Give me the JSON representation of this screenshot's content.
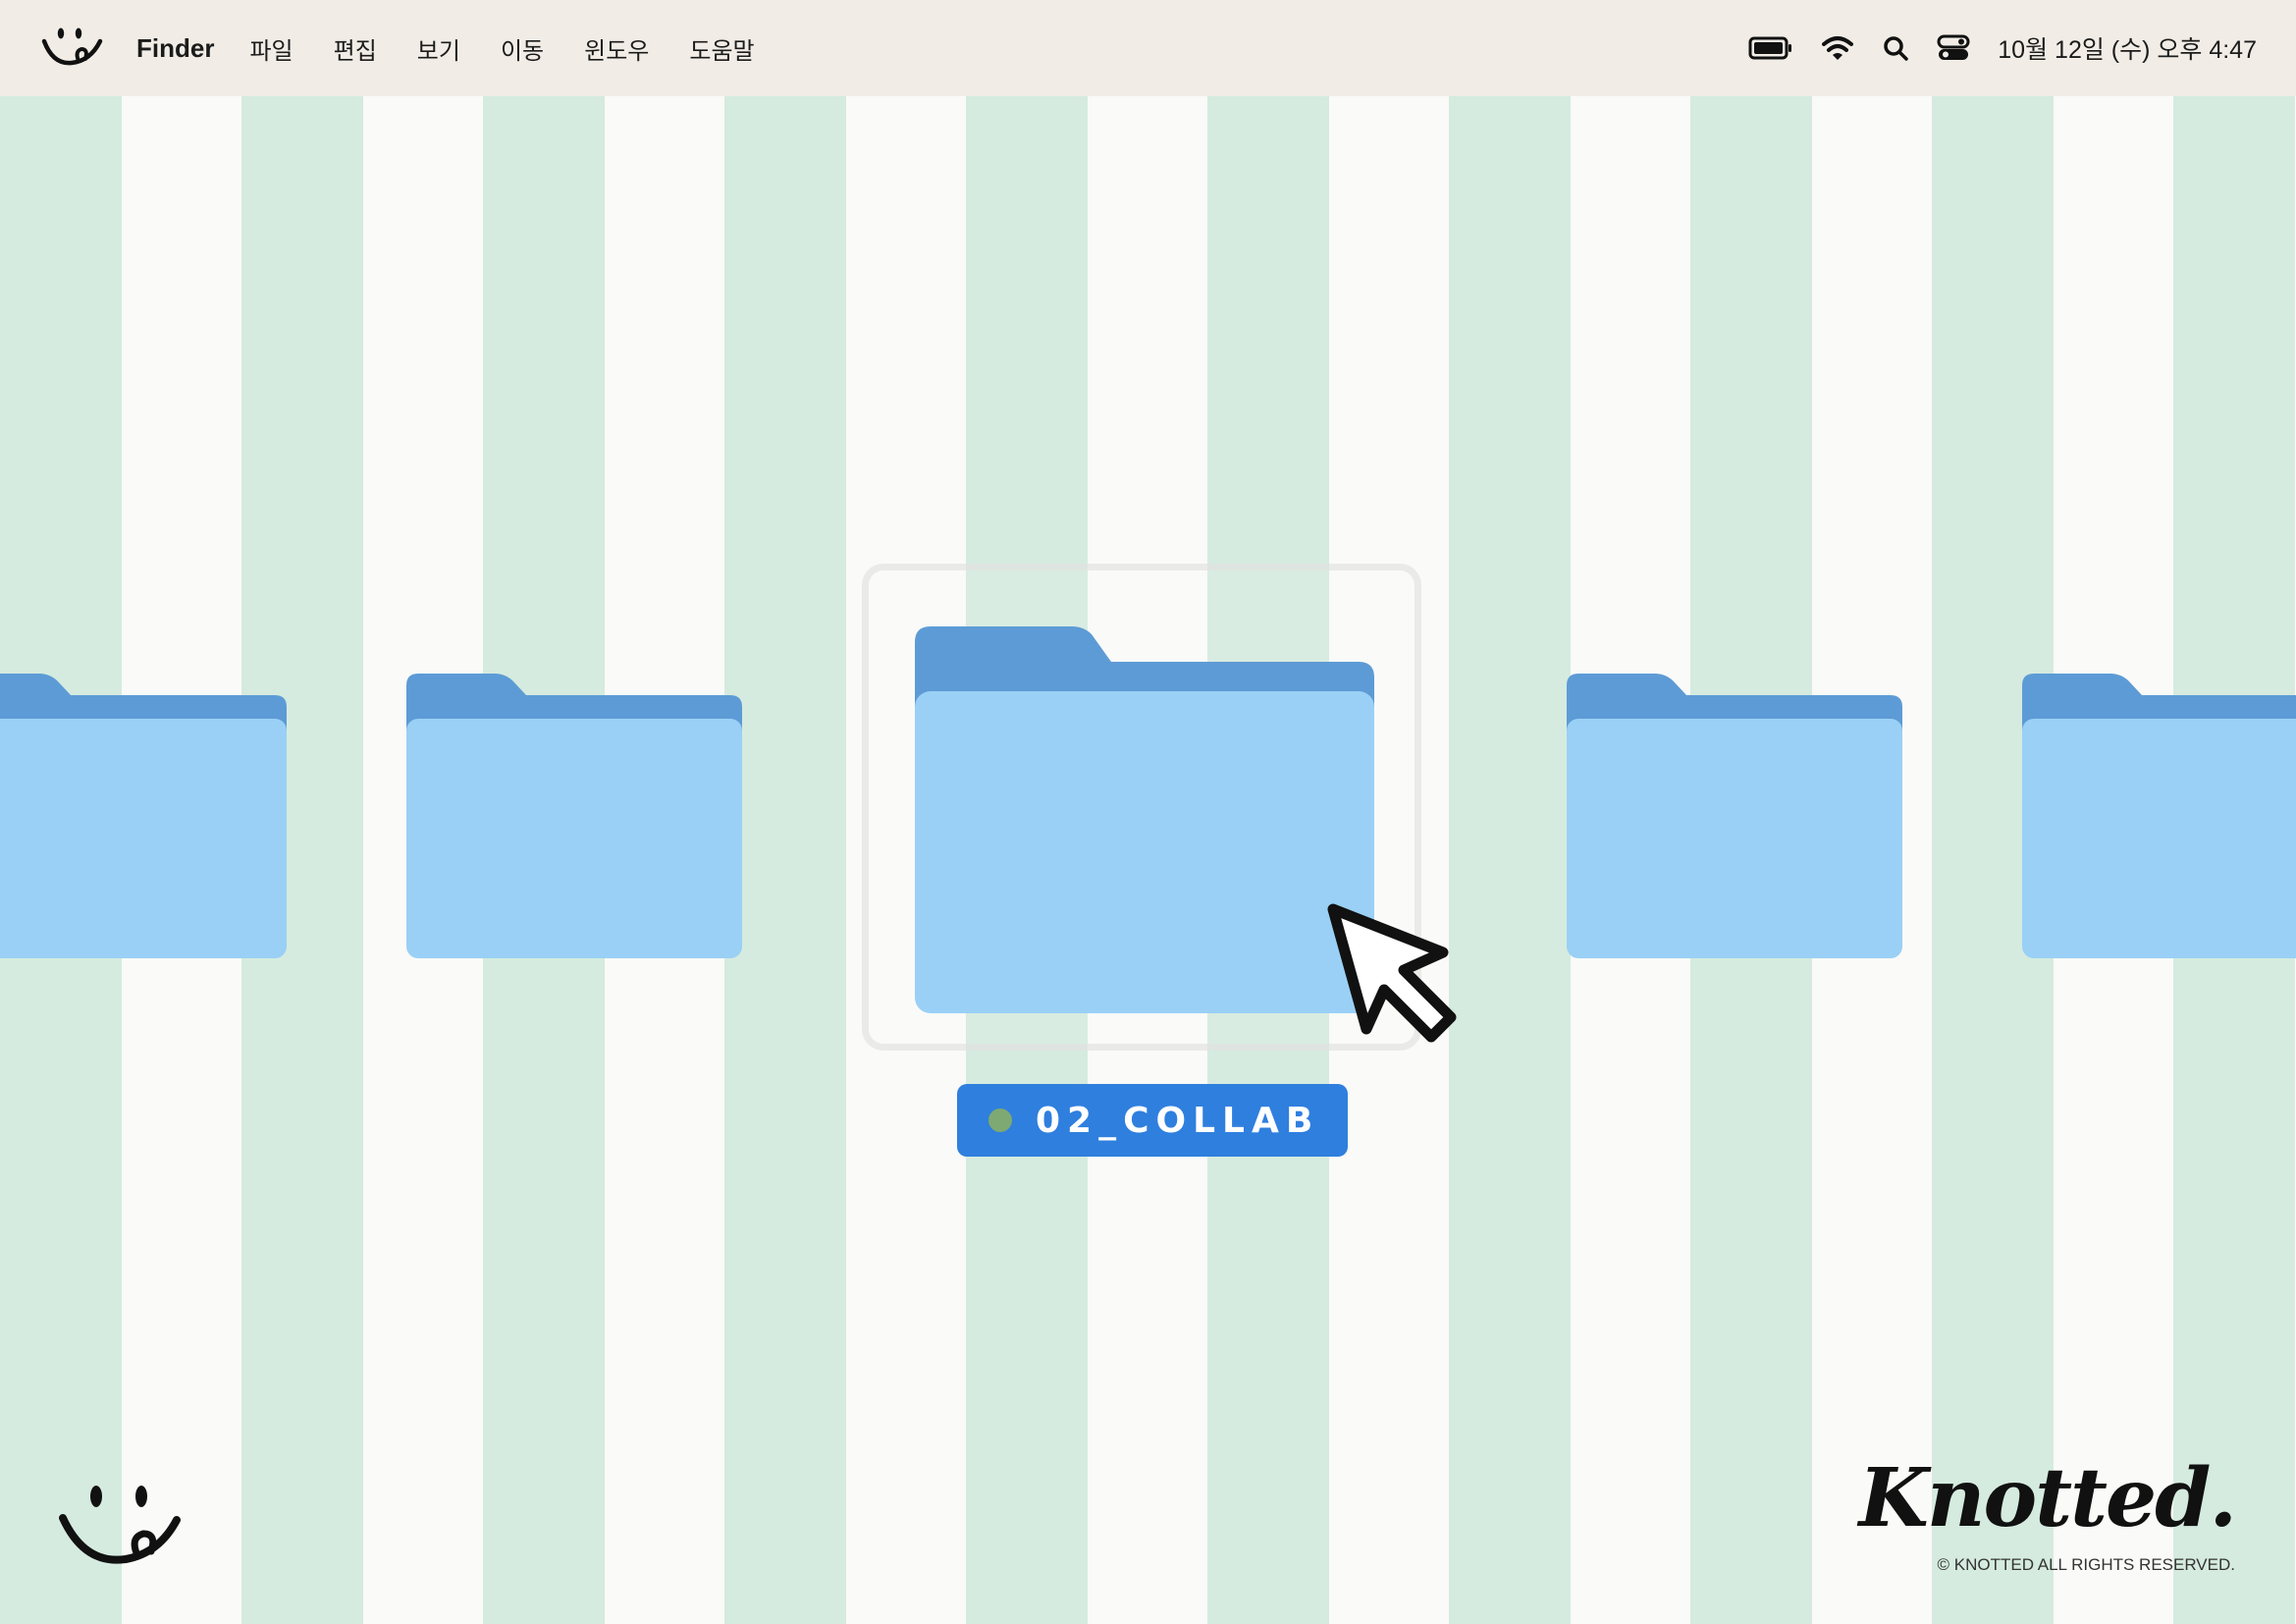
{
  "menubar": {
    "logo_icon": "smiley-logo-icon",
    "app_name": "Finder",
    "menus": [
      "파일",
      "편집",
      "보기",
      "이동",
      "윈도우",
      "도움말"
    ],
    "status_icons": [
      "battery-icon",
      "wifi-icon",
      "search-icon",
      "control-center-icon"
    ],
    "clock": "10월 12일 (수) 오후 4:47"
  },
  "desktop": {
    "folders": [
      {
        "name": "",
        "selected": false
      },
      {
        "name": "",
        "selected": false
      },
      {
        "name": "02_COLLAB",
        "selected": true
      },
      {
        "name": "",
        "selected": false
      },
      {
        "name": "",
        "selected": false
      }
    ],
    "selected_folder_label": "02_COLLAB",
    "selected_folder_tag_color": "#7fa972",
    "cursor_icon": "arrow-cursor-icon"
  },
  "branding": {
    "corner_logo_icon": "smiley-logo-icon",
    "wordmark": "Knotted.",
    "copyright": "© KNOTTED ALL RIGHTS RESERVED."
  },
  "colors": {
    "menubar_bg": "#f1ede6",
    "stripe_green": "#d5ebdf",
    "stripe_white": "#fafaf8",
    "folder_front": "#9ad0f5",
    "folder_back": "#5d9bd6",
    "label_bg": "#2f7fde"
  }
}
